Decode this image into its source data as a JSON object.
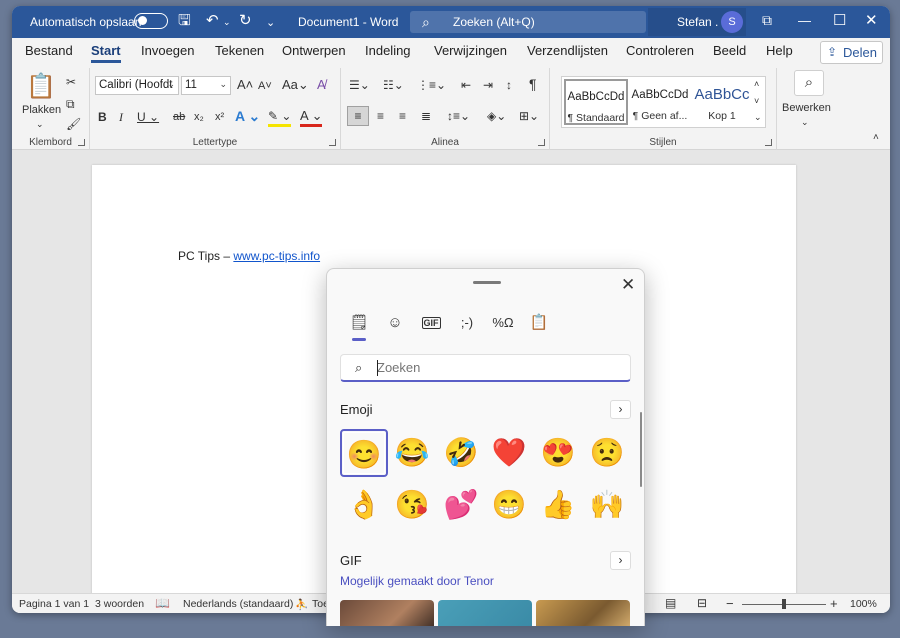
{
  "titlebar": {
    "autosave_label": "Automatisch opslaan",
    "doc_title": "Document1 - Word",
    "search_placeholder": "Zoeken (Alt+Q)",
    "user_name": "Stefan .",
    "user_initial": "S"
  },
  "tabs": [
    "Bestand",
    "Start",
    "Invoegen",
    "Tekenen",
    "Ontwerpen",
    "Indeling",
    "Verwijzingen",
    "Verzendlijsten",
    "Controleren",
    "Beeld",
    "Help"
  ],
  "active_tab": "Start",
  "share_label": "Delen",
  "ribbon": {
    "groups": {
      "klembord": "Klembord",
      "lettertype": "Lettertype",
      "alinea": "Alinea",
      "stijlen": "Stijlen"
    },
    "paste_label": "Plakken",
    "font_name": "Calibri (Hoofdt",
    "font_size": "11",
    "styles": [
      {
        "preview": "AaBbCcDd",
        "name": "¶ Standaard"
      },
      {
        "preview": "AaBbCcDd",
        "name": "¶ Geen af..."
      },
      {
        "preview": "AaBbCc",
        "name": "Kop 1"
      }
    ],
    "edit_label": "Bewerken"
  },
  "document": {
    "text_prefix": "PC Tips – ",
    "link_text": "www.pc-tips.info"
  },
  "statusbar": {
    "page": "Pagina 1 van 1",
    "words": "3 woorden",
    "language": "Nederlands (standaard)",
    "accessibility": "Toe",
    "zoom": "100%"
  },
  "emoji_panel": {
    "search_placeholder": "Zoeken",
    "emoji_section": "Emoji",
    "gif_section": "GIF",
    "tenor_credit": "Mogelijk gemaakt door Tenor",
    "emojis": [
      "😊",
      "😂",
      "🤣",
      "❤️",
      "😍",
      "😟",
      "👌",
      "😘",
      "💕",
      "😁",
      "👍",
      "🙌"
    ]
  },
  "colors": {
    "title_bar": "#2b579a",
    "accent": "#5b5fc7",
    "link": "#1155cc"
  }
}
